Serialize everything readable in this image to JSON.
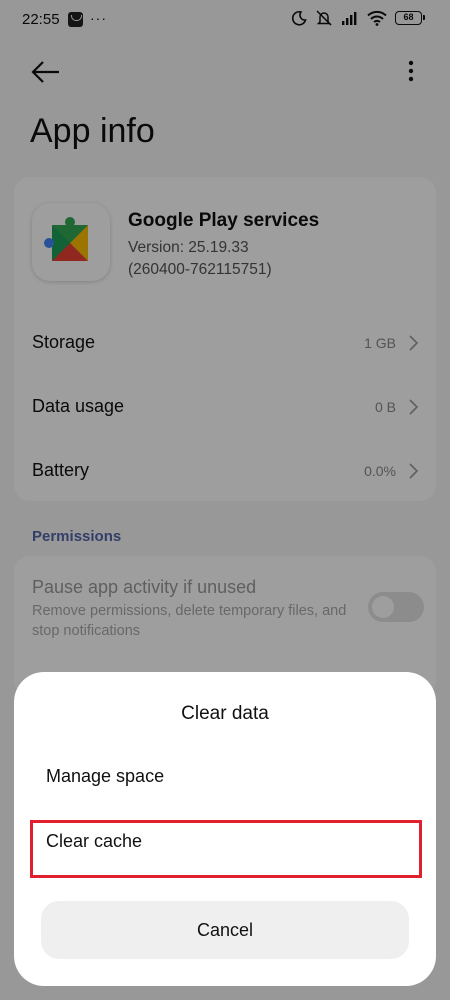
{
  "status_bar": {
    "time": "22:55",
    "more_dots": "···",
    "battery": "68"
  },
  "toolbar": {
    "back_icon": "arrow-left-icon",
    "more_icon": "more-vertical-icon"
  },
  "page": {
    "title": "App info"
  },
  "app": {
    "name": "Google Play services",
    "version": "Version: 25.19.33",
    "build": "(260400-762115751)",
    "icon": "google-play-services-icon"
  },
  "rows": [
    {
      "label": "Storage",
      "value": "1 GB"
    },
    {
      "label": "Data usage",
      "value": "0 B"
    },
    {
      "label": "Battery",
      "value": "0.0%"
    }
  ],
  "permissions": {
    "header": "Permissions",
    "pause_title": "Pause app activity if unused",
    "pause_desc": "Remove permissions, delete temporary files, and stop notifications",
    "pause_enabled": false
  },
  "dialog": {
    "title": "Clear data",
    "manage_space": "Manage space",
    "clear_cache": "Clear cache",
    "cancel": "Cancel",
    "highlight_color": "#e0202f"
  }
}
